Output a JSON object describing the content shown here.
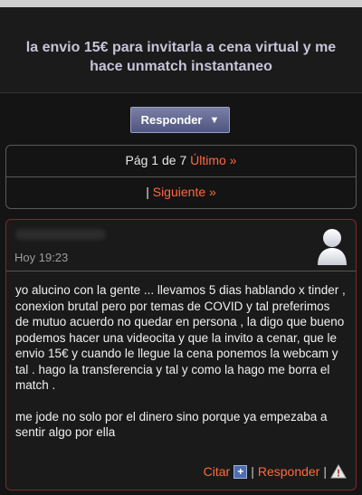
{
  "thread": {
    "title": "la envio 15€ para invitarla a cena virtual y me hace unmatch instantaneo"
  },
  "toolbar": {
    "reply_label": "Responder",
    "reply_caret": "▼"
  },
  "pagination": {
    "page_text": "Pág 1 de 7",
    "last_label": "Último »",
    "separator": "|",
    "next_label": "Siguiente »"
  },
  "post": {
    "time": "Hoy 19:23",
    "paragraphs": [
      "yo alucino con la gente ... llevamos 5 dias hablando x tinder , conexion brutal pero por temas de COVID y tal preferimos de mutuo acuerdo no quedar en persona , la digo que bueno podemos hacer una videocita y que la invito a cenar, que le envio 15€ y cuando le llegue la cena ponemos la webcam y tal . hago la transferencia y tal y como la hago me borra el match .",
      "me jode no solo por el dinero sino porque ya empezaba a sentir algo por ella"
    ],
    "actions": {
      "quote_label": "Citar",
      "plus_symbol": "+",
      "separator": "|",
      "reply_label": "Responder",
      "report_icon": "warning-icon"
    }
  },
  "colors": {
    "link": "#ff6a3c",
    "title": "#c6c4d8",
    "post_border": "#7a2a2a"
  }
}
